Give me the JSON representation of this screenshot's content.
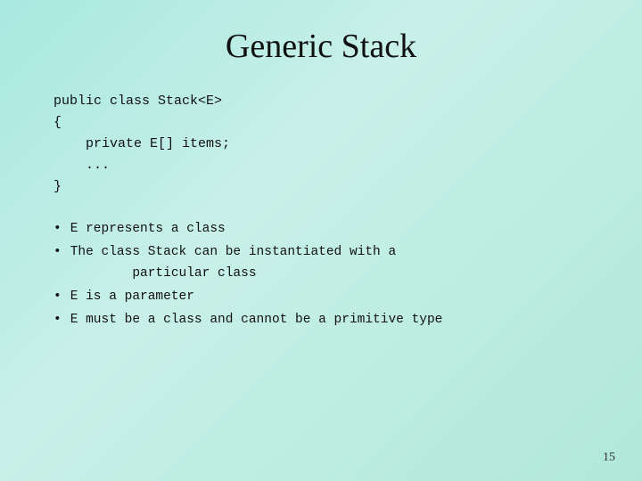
{
  "slide": {
    "title": "Generic Stack",
    "code": {
      "lines": [
        "public class Stack<E>",
        "{",
        "    private E[] items;",
        "    ...",
        "}"
      ]
    },
    "bullets": [
      "E represents a class",
      "The class Stack can be instantiated with a\n        particular class",
      "E is a parameter",
      "E must be a class and cannot be a primitive type"
    ],
    "page_number": "15"
  }
}
